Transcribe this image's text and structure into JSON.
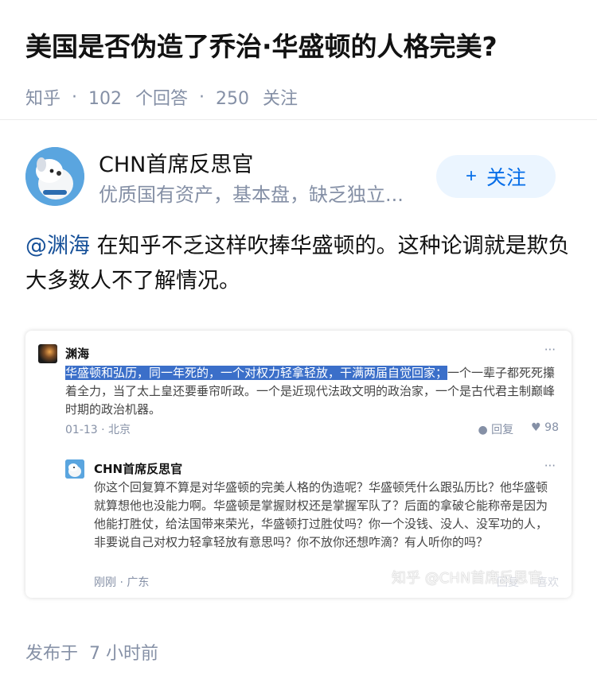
{
  "question": {
    "title": "美国是否伪造了乔治·华盛顿的人格完美?",
    "source": "知乎",
    "answers_count": "102",
    "answers_label": "个回答",
    "followers_count": "250",
    "followers_label": "关注"
  },
  "author": {
    "name": "CHN首席反思官",
    "description": "优质国有资产，基本盘，缺乏独立...",
    "follow_label": "关注",
    "follow_icon": "plus-icon"
  },
  "answer": {
    "mention": "@渊海",
    "text": " 在知乎不乏这样吹捧华盛顿的。这种论调就是欺负大多数人不了解情况。"
  },
  "screenshot": {
    "comment1": {
      "author": "渊海",
      "highlighted": "华盛顿和弘历，同一年死的，一个对权力轻拿轻放，干满两届自觉回家；",
      "rest": "一个一辈子都死死攥着全力，当了太上皇还要垂帘听政。一个是近现代法政文明的政治家，一个是古代君主制巅峰时期的政治机器。",
      "date": "01-13",
      "location": "北京",
      "reply_label": "回复",
      "likes": "98"
    },
    "comment2": {
      "author": "CHN首席反思官",
      "text": "你这个回复算不算是对华盛顿的完美人格的伪造呢？华盛顿凭什么跟弘历比？他华盛顿就算想他也没能力啊。华盛顿是掌握财权还是掌握军队了？后面的拿破仑能称帝是因为他能打胜仗，给法国带来荣光，华盛顿打过胜仗吗？你一个没钱、没人、没军功的人，非要说自己对权力轻拿轻放有意思吗？你不放你还想咋滴？有人听你的吗？",
      "date": "刚刚",
      "location": "广东",
      "reply_label": "回复",
      "likes_label": "喜欢"
    },
    "watermark": "知乎 @CHN首席反思官"
  },
  "publish": {
    "label": "发布于",
    "time": "7 小时前"
  },
  "colors": {
    "accent": "#056de8",
    "meta": "#8590a6",
    "highlight": "#3b6fc9"
  }
}
